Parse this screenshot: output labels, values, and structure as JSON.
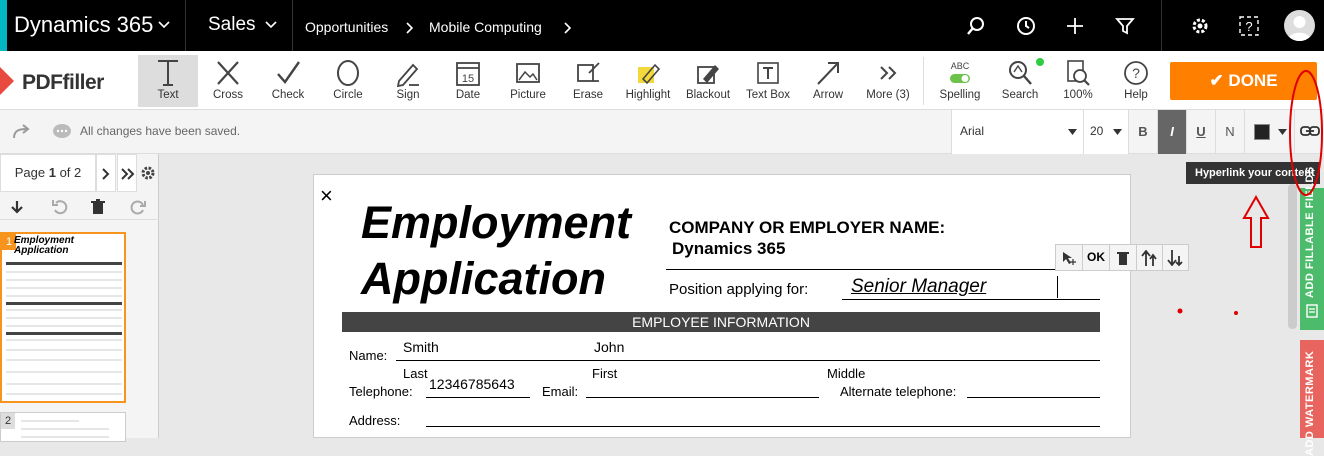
{
  "nav": {
    "brand": "Dynamics 365",
    "area": "Sales",
    "breadcrumb": [
      "Opportunities",
      "Mobile Computing"
    ],
    "icons": [
      "search-icon",
      "history-icon",
      "plus-icon",
      "filter-icon",
      "gear-icon",
      "help-icon",
      "avatar"
    ]
  },
  "toolbar": {
    "logo": "PDFfiller",
    "tools": [
      {
        "label": "Text",
        "icon": "text-icon",
        "active": true
      },
      {
        "label": "Cross",
        "icon": "cross-icon"
      },
      {
        "label": "Check",
        "icon": "check-icon"
      },
      {
        "label": "Circle",
        "icon": "circle-icon"
      },
      {
        "label": "Sign",
        "icon": "sign-icon"
      },
      {
        "label": "Date",
        "icon": "date-icon"
      },
      {
        "label": "Picture",
        "icon": "picture-icon"
      },
      {
        "label": "Erase",
        "icon": "erase-icon"
      },
      {
        "label": "Highlight",
        "icon": "highlight-icon"
      },
      {
        "label": "Blackout",
        "icon": "blackout-icon"
      },
      {
        "label": "Text Box",
        "icon": "textbox-icon"
      },
      {
        "label": "Arrow",
        "icon": "arrow-icon"
      },
      {
        "label": "More (3)",
        "icon": "more-icon"
      },
      {
        "label": "Spelling",
        "icon": "spelling-icon",
        "badge": "ABC"
      },
      {
        "label": "Search",
        "icon": "search-icon"
      },
      {
        "label": "100%",
        "icon": "zoom-icon"
      },
      {
        "label": "Help",
        "icon": "help-icon"
      }
    ],
    "done_label": "DONE"
  },
  "options": {
    "status": "All changes have been saved.",
    "font": "Arial",
    "size": "20",
    "bold": "B",
    "italic": "I",
    "underline": "U",
    "normal": "N",
    "tooltip": "Hyperlink your content"
  },
  "pager": {
    "label": "Page",
    "current": "1",
    "of": "of 2",
    "thumbs": [
      "1",
      "2"
    ]
  },
  "document": {
    "title_line1": "Employment",
    "title_line2": "Application",
    "company_label": "COMPANY OR EMPLOYER NAME:",
    "company_value": "Dynamics 365",
    "position_label": "Position applying for:",
    "position_value": "Senior Manager",
    "section": "EMPLOYEE INFORMATION",
    "name_label": "Name:",
    "last_value": "Smith",
    "first_value": "John",
    "last_label": "Last",
    "first_label": "First",
    "middle_label": "Middle",
    "telephone_label": "Telephone:",
    "telephone_value": "12346785643",
    "email_label": "Email:",
    "alt_tel_label": "Alternate telephone:",
    "address_label": "Address:",
    "close": "×"
  },
  "field_controls": {
    "ok": "OK"
  },
  "side_tabs": {
    "fillable": "ADD FILLABLE FIELDS",
    "watermark": "ADD WATERMARK"
  },
  "colors": {
    "accent": "#00b7c3",
    "done": "#ff7f00",
    "annotation": "#e00000",
    "fillable_tab": "#4cbb6c",
    "watermark_tab": "#e8655f"
  }
}
